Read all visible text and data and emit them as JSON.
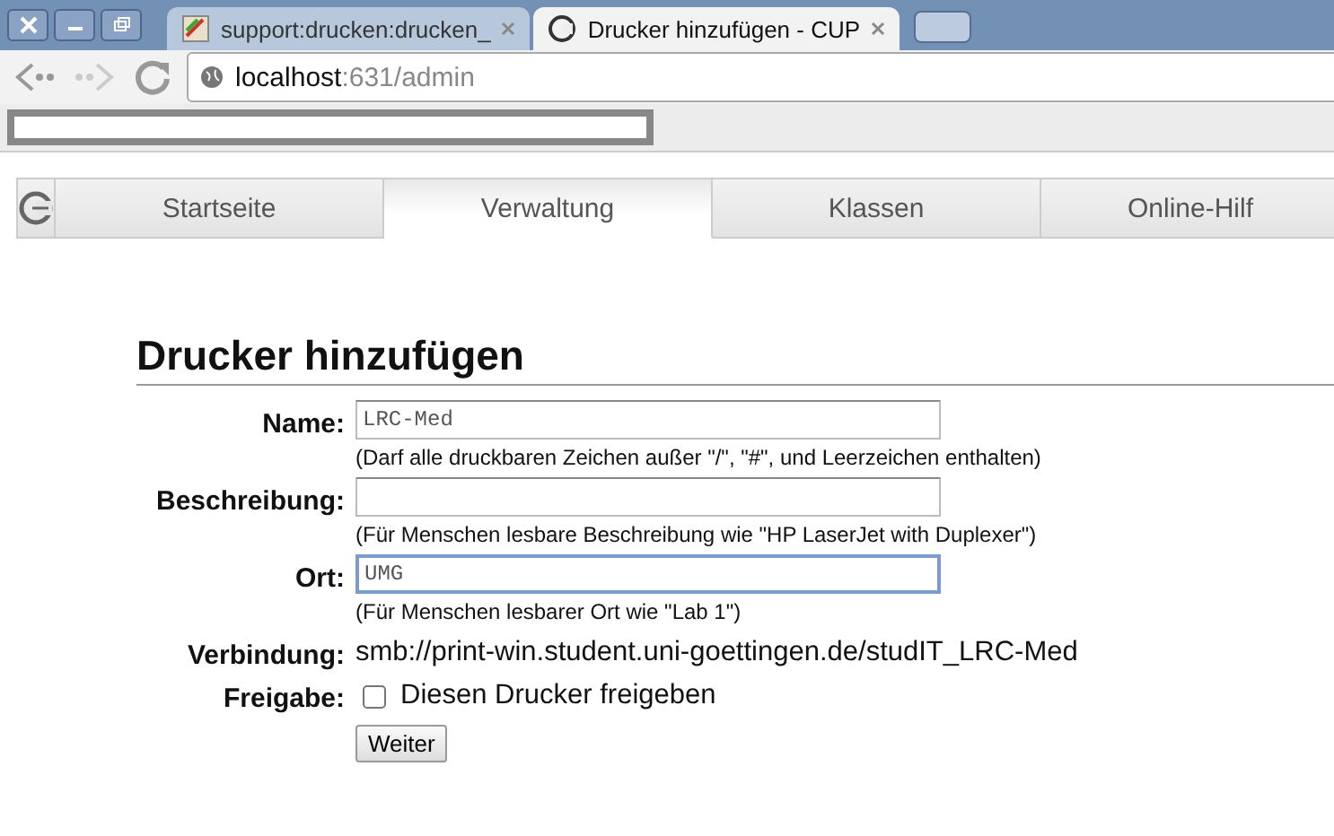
{
  "browser": {
    "tabs": [
      {
        "title": "support:drucken:drucken_",
        "selected": false
      },
      {
        "title": "Drucker hinzufügen - CUP",
        "selected": true
      }
    ],
    "address": {
      "host": "localhost",
      "path": ":631/admin"
    }
  },
  "nav": {
    "tabs": [
      {
        "label": "Startseite",
        "selected": false
      },
      {
        "label": "Verwaltung",
        "selected": true
      },
      {
        "label": "Klassen",
        "selected": false
      },
      {
        "label": "Online-Hilf",
        "selected": false
      }
    ]
  },
  "heading": "Drucker hinzufügen",
  "form": [
    {
      "kind": "input",
      "label": "Name:",
      "value": "LRC-Med",
      "focused": false,
      "hint": "(Darf alle druckbaren Zeichen außer \"/\", \"#\", und Leerzeichen enthalten)"
    },
    {
      "kind": "input",
      "label": "Beschreibung:",
      "focused": false,
      "hint": "(Für Menschen lesbare Beschreibung wie \"HP LaserJet with Duplexer\")"
    },
    {
      "kind": "input",
      "label": "Ort:",
      "value": "UMG",
      "focused": true,
      "hint": "(Für Menschen lesbarer Ort wie \"Lab 1\")"
    },
    {
      "kind": "text",
      "label": "Verbindung:",
      "value": "smb://print-win.student.uni-goettingen.de/studIT_LRC-Med"
    },
    {
      "kind": "checkbox",
      "label": "Freigabe:",
      "value": "Diesen Drucker freigeben",
      "checked": false
    }
  ],
  "submit": "Weiter"
}
